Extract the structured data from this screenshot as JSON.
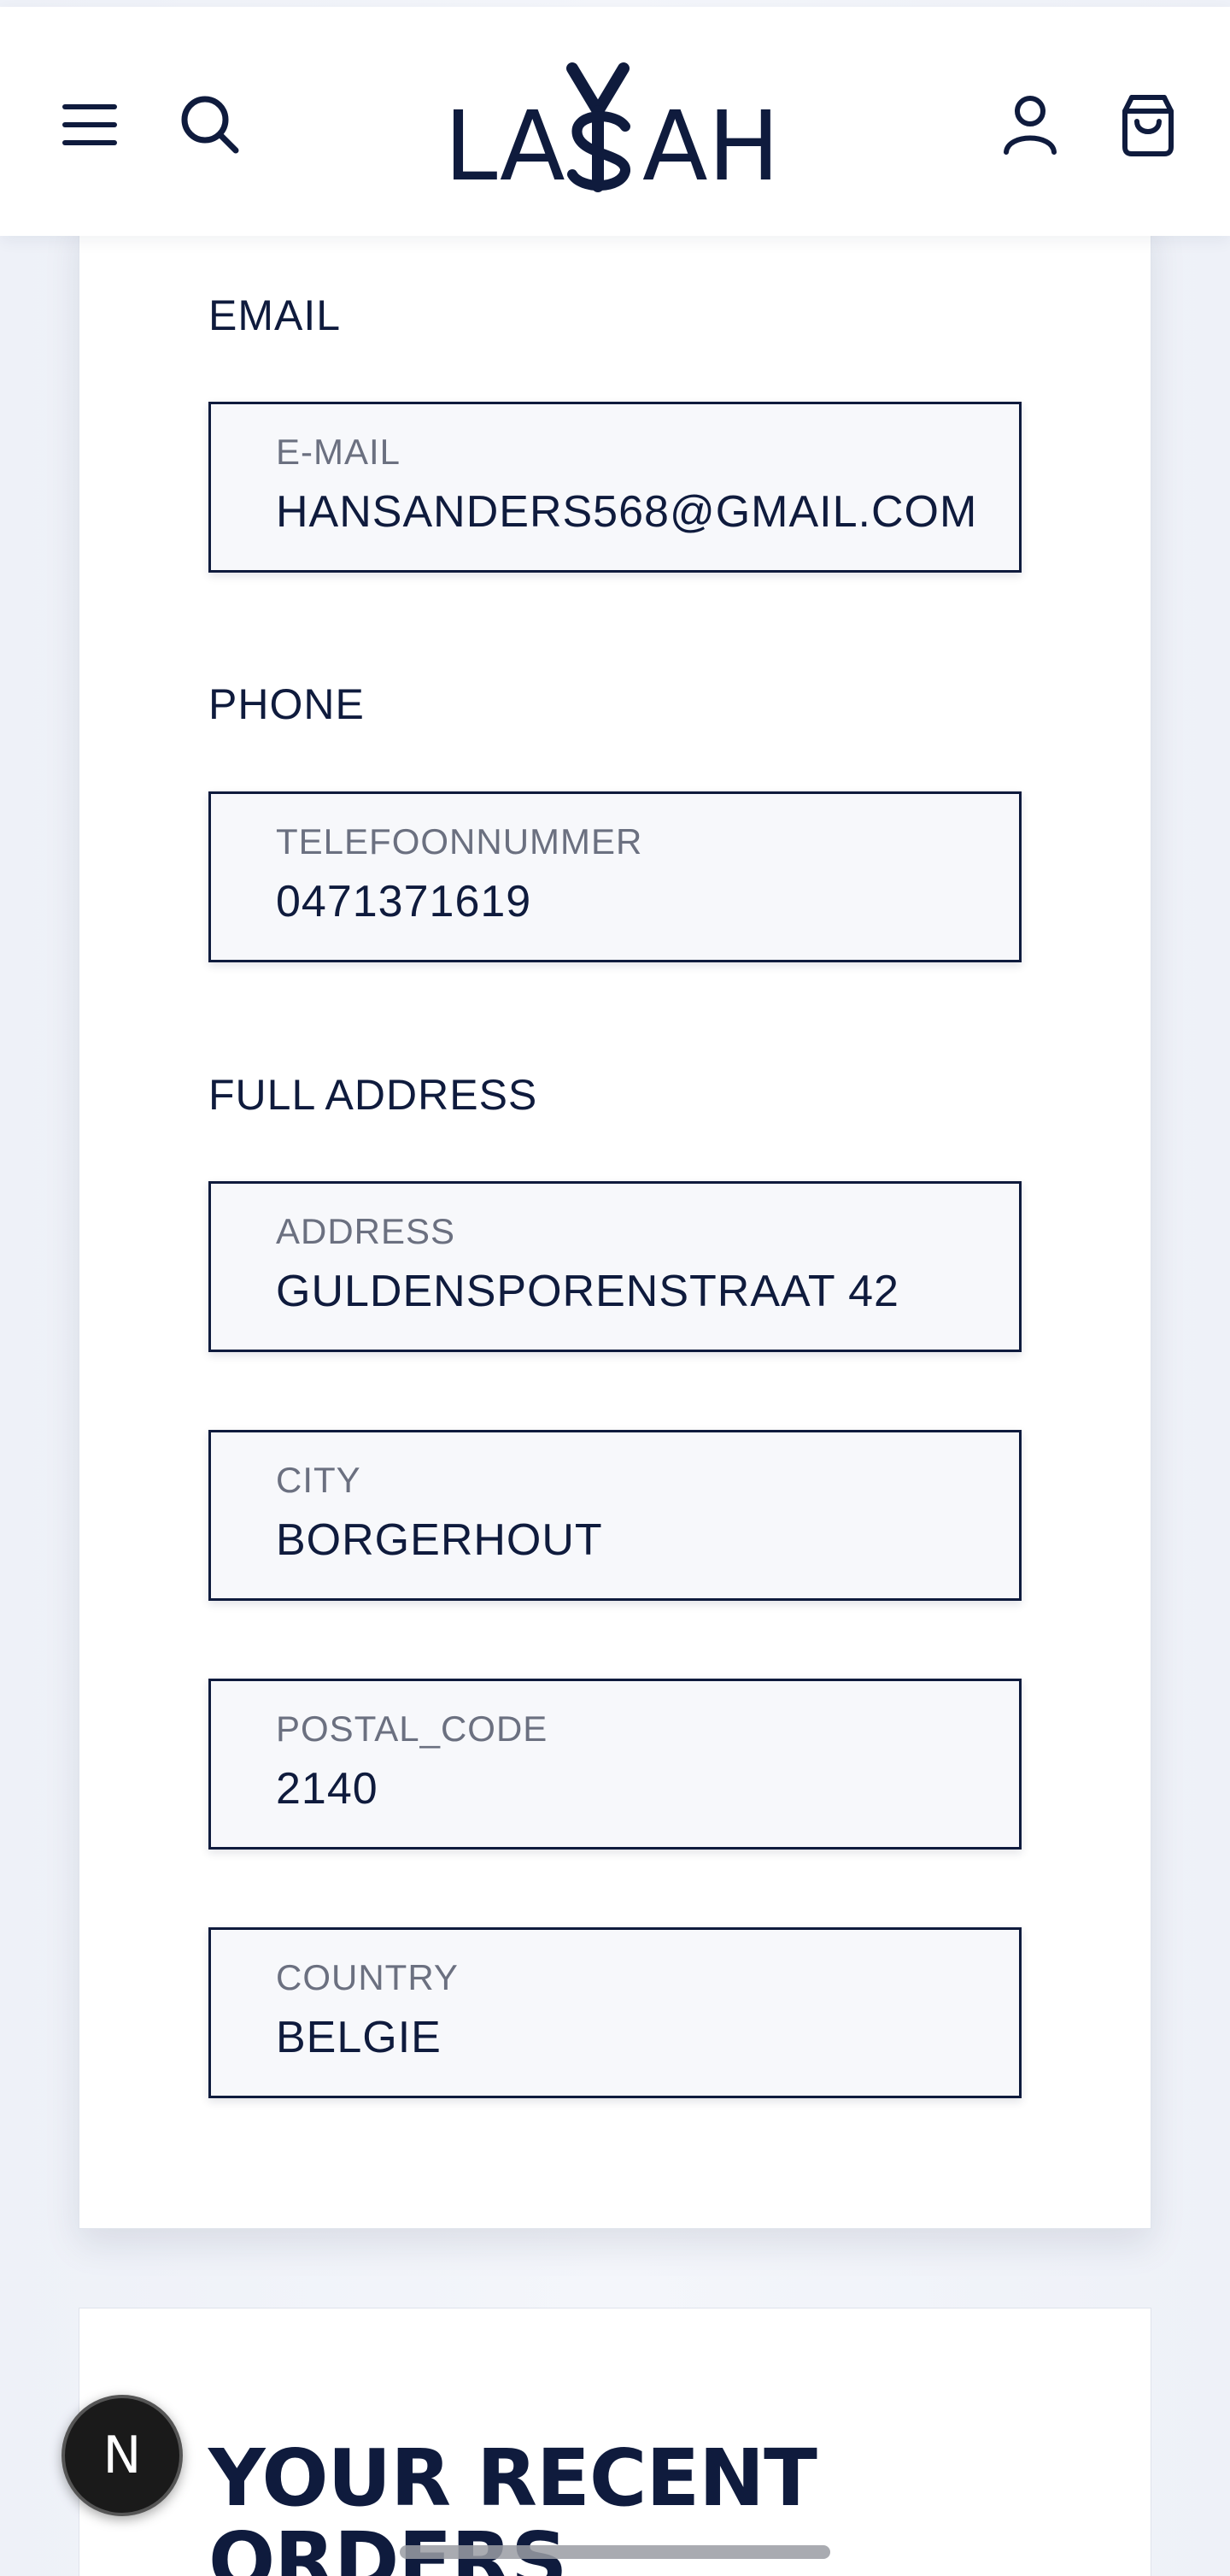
{
  "brand": {
    "name": "LASAH",
    "logo_left": "LA",
    "logo_right": "AH"
  },
  "header": {
    "menu_icon": "hamburger-menu-icon",
    "search_icon": "search-icon",
    "account_icon": "user-icon",
    "cart_icon": "shopping-bag-icon"
  },
  "sections": {
    "email": "EMAIL",
    "phone": "PHONE",
    "address": "FULL ADDRESS"
  },
  "fields": {
    "email": {
      "label": "E-MAIL",
      "value": "HANSANDERS568@GMAIL.COM"
    },
    "phone": {
      "label": "TELEFOONNUMMER",
      "value": "0471371619"
    },
    "address": {
      "label": "ADDRESS",
      "value": "GULDENSPORENSTRAAT 42"
    },
    "city": {
      "label": "CITY",
      "value": "BORGERHOUT"
    },
    "postal_code": {
      "label": "POSTAL_CODE",
      "value": "2140"
    },
    "country": {
      "label": "COUNTRY",
      "value": "BELGIE"
    }
  },
  "orders": {
    "title": "YOUR RECENT ORDERS"
  },
  "floating_button": {
    "label": "N"
  },
  "colors": {
    "navy": "#0f1b3d",
    "field_bg": "#f7f8fb",
    "label_gray": "#6b7080"
  }
}
